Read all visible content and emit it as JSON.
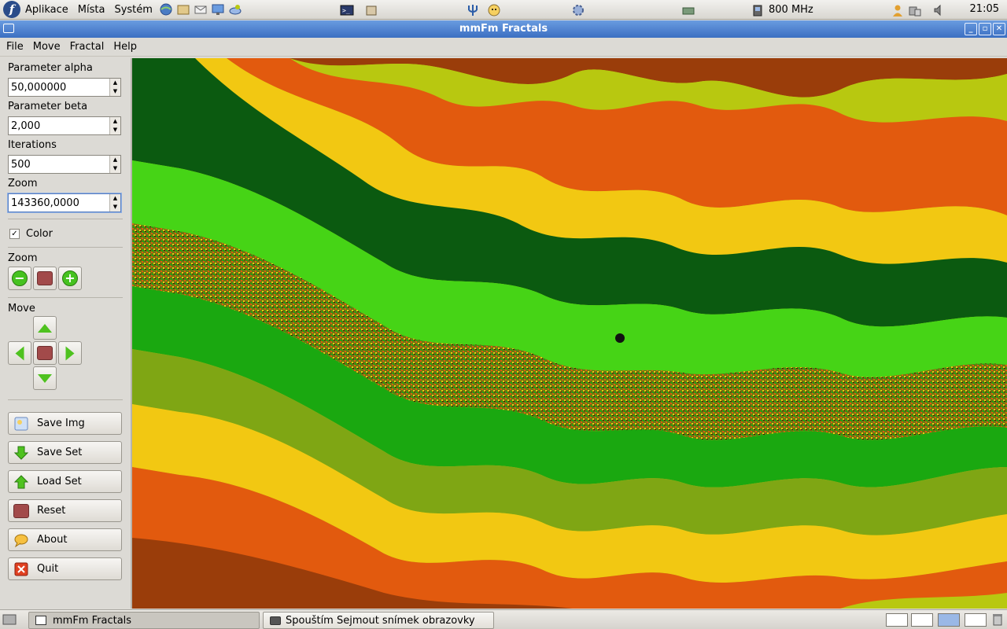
{
  "top_panel": {
    "menus": [
      "Aplikace",
      "Místa",
      "Systém"
    ],
    "launchers": [
      "browser-icon",
      "files-icon",
      "mail-icon",
      "presentation-icon",
      "network-icon"
    ],
    "center_icons": [
      "terminal-icon",
      "package-icon",
      "trident-icon",
      "face-icon",
      "gear-icon",
      "network-manager-icon"
    ],
    "cpu_freq": "800 MHz",
    "clock": "21:05"
  },
  "window": {
    "title": "mmFm Fractals",
    "menu": [
      "File",
      "Move",
      "Fractal",
      "Help"
    ]
  },
  "params": {
    "alpha_label": "Parameter alpha",
    "alpha_value": "50,000000",
    "beta_label": "Parameter beta",
    "beta_value": "2,000",
    "iterations_label": "Iterations",
    "iterations_value": "500",
    "zoom_label": "Zoom",
    "zoom_value": "143360,0000",
    "color_label": "Color",
    "color_checked": true
  },
  "zoom_section": {
    "title": "Zoom"
  },
  "move_section": {
    "title": "Move"
  },
  "buttons": {
    "save_img": "Save Img",
    "save_set": "Save Set",
    "load_set": "Load Set",
    "reset": "Reset",
    "about": "About",
    "quit": "Quit"
  },
  "taskbar": {
    "tasks": [
      "mmFm Fractals",
      "Spouštím Sejmout snímek obrazovky"
    ]
  },
  "colors": {
    "band_colors": [
      "#9a3d0a",
      "#e25a0e",
      "#f2c812",
      "#b8c810",
      "#7fa614",
      "#46d416",
      "#1aa810",
      "#0b5a10"
    ]
  }
}
